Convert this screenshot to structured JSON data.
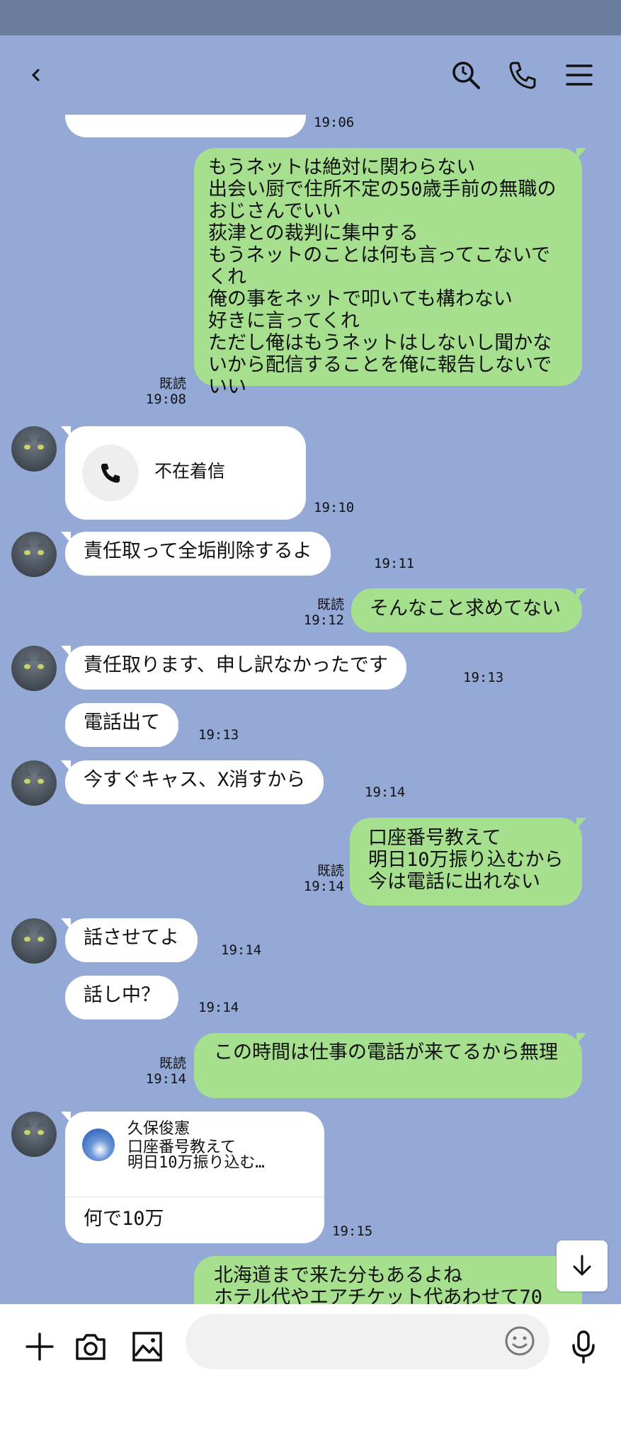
{
  "colors": {
    "background": "#95a9d6",
    "outgoing_bubble": "#a6e08f",
    "incoming_bubble": "#ffffff",
    "status_bar": "#6b7d9c"
  },
  "header": {
    "icons": [
      "back-icon",
      "search-icon",
      "phone-icon",
      "menu-icon"
    ]
  },
  "messages": [
    {
      "time": "19:06"
    },
    {
      "text": "もうネットは絶対に関わらない\n出会い厨で住所不定の50歳手前の無職のおじさんでいい\n荻津との裁判に集中する\nもうネットのことは何も言ってこないでくれ\n俺の事をネットで叩いても構わない\n好きに言ってくれ\nただし俺はもうネットはしないし聞かないから配信することを俺に報告しないでいい",
      "read": "既読",
      "time": "19:08"
    },
    {
      "call_label": "不在着信",
      "time": "19:10"
    },
    {
      "text": "責任取って全垢削除するよ",
      "time": "19:11"
    },
    {
      "text": "そんなこと求めてない",
      "read": "既読",
      "time": "19:12"
    },
    {
      "text": "責任取ります、申し訳なかったです",
      "time": "19:13"
    },
    {
      "text": "電話出て",
      "time": "19:13"
    },
    {
      "text": "今すぐキャス、X消すから",
      "time": "19:14"
    },
    {
      "text": "口座番号教えて\n明日10万振り込むから\n今は電話に出れない",
      "read": "既読",
      "time": "19:14"
    },
    {
      "text": "話させてよ",
      "time": "19:14"
    },
    {
      "text": "話し中？",
      "time": "19:14"
    },
    {
      "text": "この時間は仕事の電話が来てるから無理",
      "read": "既読",
      "time": "19:14"
    },
    {
      "reply_name": "久保俊憲",
      "reply_quote": "口座番号教えて\n明日10万振り込む…",
      "text": "何で10万",
      "time": "19:15"
    },
    {
      "text": "北海道まで来た分もあるよね\nホテル代やエアチケット代あわせて70"
    }
  ],
  "input": {
    "placeholder": ""
  },
  "toolbar_icons": [
    "plus-icon",
    "camera-icon",
    "image-icon",
    "emoji-icon",
    "mic-icon"
  ]
}
